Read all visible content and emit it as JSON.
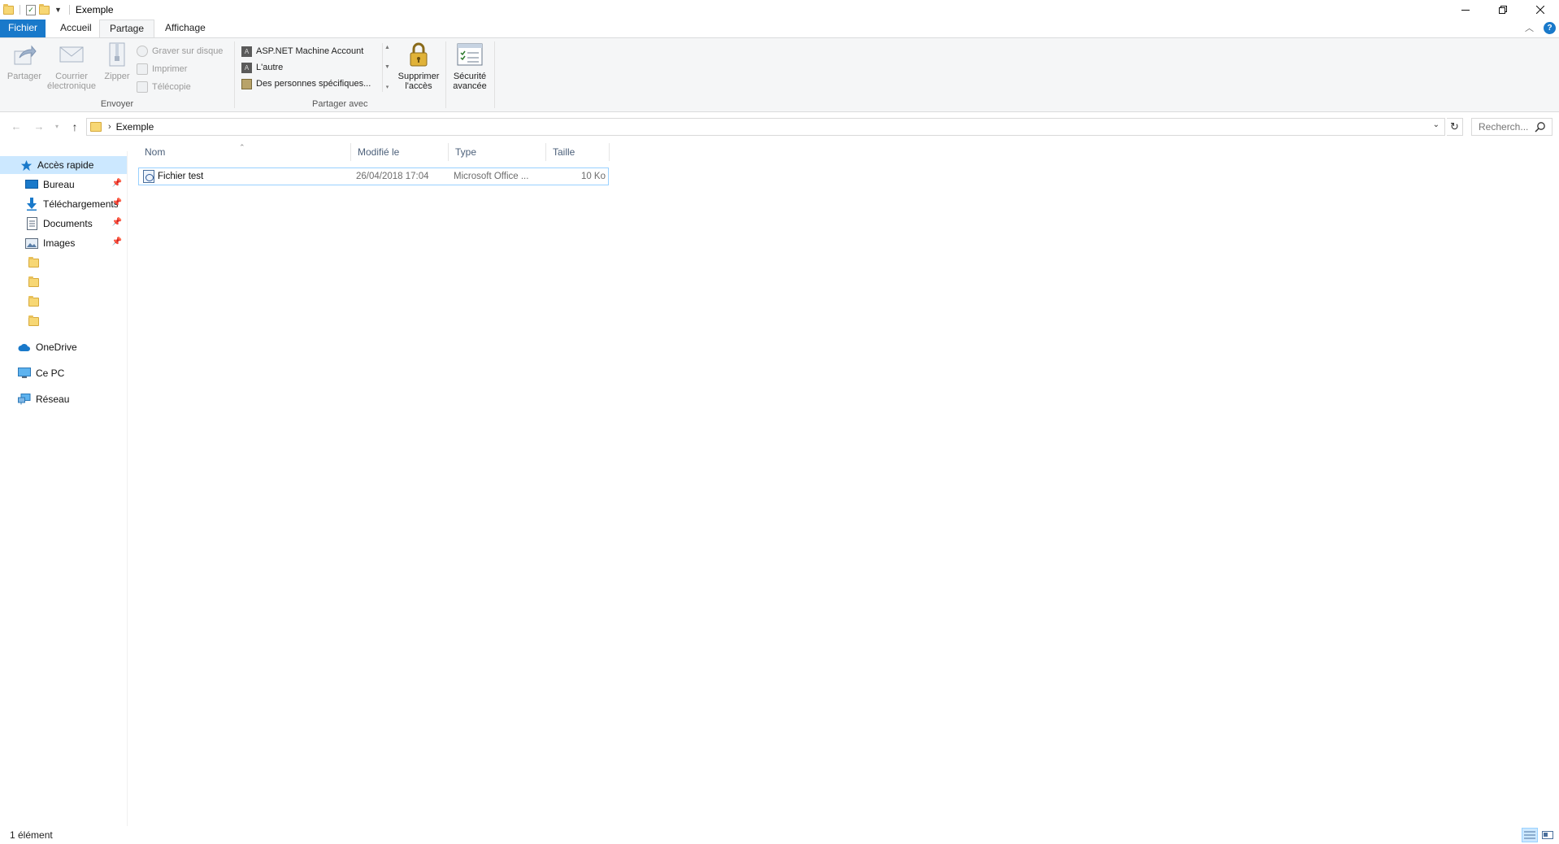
{
  "window": {
    "title": "Exemple",
    "minimize_icon": "minimize-icon",
    "restore_icon": "restore-icon",
    "close_icon": "close-icon"
  },
  "ribbon_tabs": [
    {
      "label": "Fichier"
    },
    {
      "label": "Accueil"
    },
    {
      "label": "Partage"
    },
    {
      "label": "Affichage"
    }
  ],
  "ribbon": {
    "envoyer": {
      "group_label": "Envoyer",
      "partager": "Partager",
      "courrier_line1": "Courrier",
      "courrier_line2": "électronique",
      "zipper": "Zipper",
      "graver": "Graver sur disque",
      "imprimer": "Imprimer",
      "telecopie": "Télécopie"
    },
    "partager_avec": {
      "group_label": "Partager avec",
      "items": [
        {
          "label": "ASP.NET Machine Account"
        },
        {
          "label": "L'autre"
        },
        {
          "label": "Des personnes spécifiques..."
        }
      ],
      "supprimer_line1": "Supprimer",
      "supprimer_line2": "l'accès"
    },
    "securite": {
      "line1": "Sécurité",
      "line2": "avancée"
    }
  },
  "address": {
    "path": "Exemple",
    "search_placeholder": "Recherch..."
  },
  "nav": {
    "quick_access": "Accès rapide",
    "pinned": [
      {
        "label": "Bureau",
        "icon": "desktop-icon"
      },
      {
        "label": "Téléchargements",
        "icon": "download-icon"
      },
      {
        "label": "Documents",
        "icon": "documents-icon"
      },
      {
        "label": "Images",
        "icon": "images-icon"
      }
    ],
    "onedrive": "OneDrive",
    "ce_pc": "Ce PC",
    "reseau": "Réseau"
  },
  "columns": [
    {
      "label": "Nom"
    },
    {
      "label": "Modifié le"
    },
    {
      "label": "Type"
    },
    {
      "label": "Taille"
    }
  ],
  "files": [
    {
      "name": "Fichier test",
      "modified": "26/04/2018 17:04",
      "type": "Microsoft Office ...",
      "size": "10 Ko"
    }
  ],
  "status": {
    "count": "1 élément"
  },
  "colors": {
    "accent": "#1979ca",
    "selection": "#cce8ff",
    "folder": "#f7d774"
  }
}
